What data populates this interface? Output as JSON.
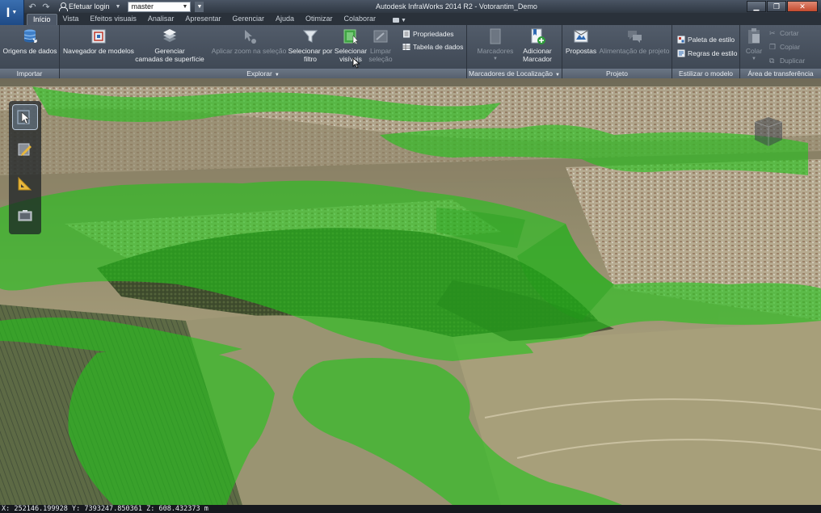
{
  "window": {
    "title": "Autodesk InfraWorks 2014 R2 - Votorantim_Demo",
    "app_letter": "I",
    "login_label": "Efetuar login",
    "proposal_value": "master"
  },
  "tabs": [
    {
      "label": "Início",
      "active": true
    },
    {
      "label": "Vista"
    },
    {
      "label": "Efeitos visuais"
    },
    {
      "label": "Analisar"
    },
    {
      "label": "Apresentar"
    },
    {
      "label": "Gerenciar"
    },
    {
      "label": "Ajuda"
    },
    {
      "label": "Otimizar"
    },
    {
      "label": "Colaborar"
    }
  ],
  "ribbon": {
    "importar": {
      "label": "Importar",
      "data_sources": "Origens de dados"
    },
    "explorar": {
      "label": "Explorar",
      "model_explorer": "Navegador de modelos",
      "manage_surface_1": "Gerenciar",
      "manage_surface_2": "camadas de superfície",
      "zoom_selection": "Aplicar zoom na seleção",
      "select_filter_1": "Selecionar por",
      "select_filter_2": "filtro",
      "select_visible_1": "Selecionar",
      "select_visible_2": "visíveis",
      "clear_selection_1": "Limpar",
      "clear_selection_2": "seleção",
      "properties": "Propriedades",
      "data_table": "Tabela de dados"
    },
    "marcadores": {
      "label": "Marcadores de Localização",
      "bookmarks": "Marcadores",
      "add_bookmark_1": "Adicionar",
      "add_bookmark_2": "Marcador"
    },
    "projeto": {
      "label": "Projeto",
      "proposals": "Propostas",
      "project_feed": "Alimentação de projeto"
    },
    "estilizar": {
      "label": "Estilizar o modelo",
      "style_palette": "Paleta de estilo",
      "style_rules": "Regras de estilo"
    },
    "clipboard": {
      "label": "Área de transferência",
      "paste": "Colar",
      "cut": "Cortar",
      "copy": "Copiar",
      "duplicate": "Duplicar"
    }
  },
  "status": {
    "coordinates": "X: 252146.199928 Y: 7393247.850361 Z: 608.432373 m"
  },
  "colors": {
    "accent_blue": "#2f6ab3",
    "buffer_green": "#22c21a",
    "ribbon_bg": "#4a5461"
  }
}
